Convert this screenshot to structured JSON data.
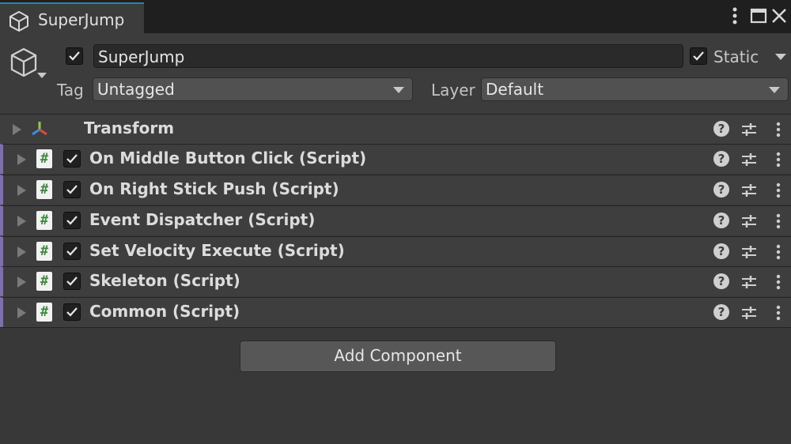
{
  "tab": {
    "title": "SuperJump",
    "icon": "cube-icon"
  },
  "window_controls": [
    "kebab-menu-icon",
    "maximize-icon",
    "close-icon"
  ],
  "gameobject": {
    "active": true,
    "name": "SuperJump",
    "static_checked": true,
    "static_label": "Static",
    "tag_label": "Tag",
    "tag_value": "Untagged",
    "layer_label": "Layer",
    "layer_value": "Default"
  },
  "components": [
    {
      "title": "Transform",
      "type": "transform",
      "icon": "transform-icon"
    },
    {
      "title": "On Middle Button Click (Script)",
      "type": "script",
      "enabled": true,
      "icon": "script-icon"
    },
    {
      "title": "On Right Stick Push (Script)",
      "type": "script",
      "enabled": true,
      "icon": "script-icon"
    },
    {
      "title": "Event Dispatcher (Script)",
      "type": "script",
      "enabled": true,
      "icon": "script-icon"
    },
    {
      "title": "Set Velocity Execute (Script)",
      "type": "script",
      "enabled": true,
      "icon": "script-icon"
    },
    {
      "title": "Skeleton (Script)",
      "type": "script",
      "enabled": true,
      "icon": "script-icon"
    },
    {
      "title": "Common (Script)",
      "type": "script",
      "enabled": true,
      "icon": "script-icon"
    }
  ],
  "script_icon_glyph": "#",
  "help_glyph": "?",
  "add_component_label": "Add Component",
  "colors": {
    "tab_accent": "#3a79bb",
    "script_stripe": "#7e6fb0",
    "script_glyph": "#3c8a3c"
  }
}
